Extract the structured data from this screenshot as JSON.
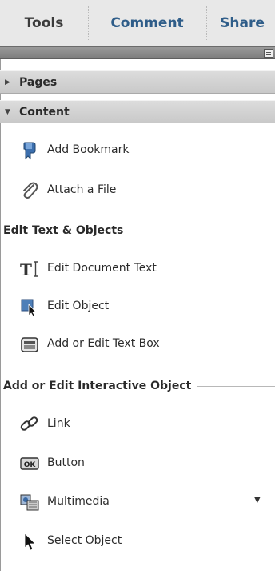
{
  "tabs": [
    {
      "label": "Tools"
    },
    {
      "label": "Comment"
    },
    {
      "label": "Share"
    }
  ],
  "panels": {
    "pages": {
      "label": "Pages",
      "expanded": false
    },
    "content": {
      "label": "Content",
      "expanded": true
    }
  },
  "items": {
    "add_bookmark": "Add Bookmark",
    "attach_file": "Attach a File"
  },
  "sections": {
    "edit_text": {
      "title": "Edit Text & Objects",
      "items": [
        "Edit Document Text",
        "Edit Object",
        "Add or Edit Text Box"
      ]
    },
    "interactive": {
      "title": "Add or Edit Interactive Object",
      "items": [
        "Link",
        "Button",
        "Multimedia",
        "Select Object"
      ]
    }
  },
  "button_icon_text": "OK",
  "colors": {
    "tab_active": "#3a3a3a",
    "tab_link": "#2f5d89"
  }
}
